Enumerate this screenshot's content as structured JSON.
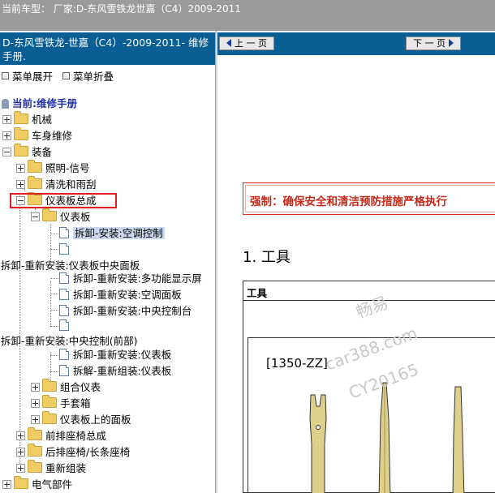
{
  "header": {
    "text": "当前车型：  厂家:D-东风雪铁龙世嘉（C4）2009-2011"
  },
  "left": {
    "title": "D-东风雪铁龙-世嘉（C4）-2009-2011- 维修手册.",
    "expand_label": "菜单展开",
    "collapse_label": "菜单折叠",
    "current_label": "当前:维修手册",
    "tree": {
      "n1": "机械",
      "n2": "车身维修",
      "n3": "装备",
      "n4": "照明-信号",
      "n5": "清洗和雨刮",
      "n6": "仪表板总成",
      "n7": "仪表板",
      "n8": "拆卸-安装:空调控制",
      "n10": "拆卸-重新安装:仪表板中央面板",
      "n11": "拆卸-重新安装:多功能显示屏",
      "n12": "拆卸-重新安装:空调面板",
      "n13": "拆卸-重新安装:中央控制台",
      "n15": "拆卸-重新安装:中央控制(前部)",
      "n16": "拆卸-重新安装:仪表板",
      "n17": "拆解-重新组装:仪表板",
      "n18": "组合仪表",
      "n19": "手套箱",
      "n20": "仪表板上的面板",
      "n21": "前排座椅总成",
      "n22": "后排座椅/长条座椅",
      "n23": "重新组装",
      "n24": "电气部件"
    }
  },
  "right": {
    "prev_label": "上 一 页",
    "next_label": "下 一 页",
    "warning": "强制：确保安全和清洁预防措施严格执行",
    "section_title": "1. 工具",
    "table_header": "工具",
    "tool_code": "[1350-ZZ]"
  },
  "watermark": {
    "line1": "畅易",
    "line2": "car388.com",
    "line3": "CY20165"
  },
  "colors": {
    "header_bg": "#9b9b9b",
    "panel_title_bg": "#0b5e94",
    "warning_red": "#c52a1a",
    "highlight": "#e02020"
  }
}
